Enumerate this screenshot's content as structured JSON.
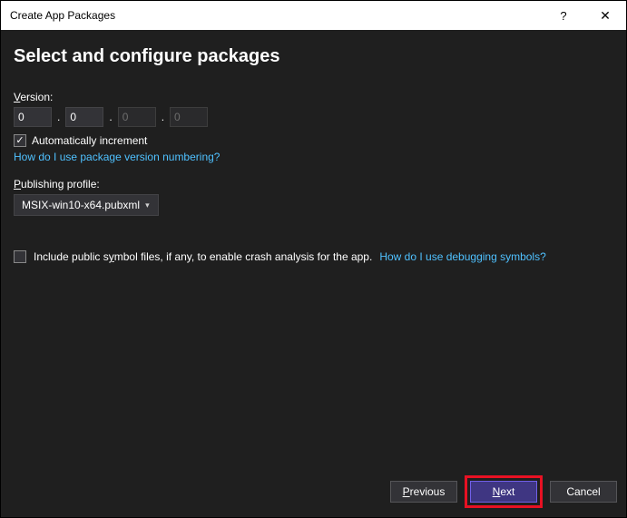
{
  "titlebar": {
    "title": "Create App Packages",
    "help": "?",
    "close": "✕"
  },
  "heading": "Select and configure packages",
  "version": {
    "label_prefix": "V",
    "label_rest": "ersion:",
    "major": "0",
    "minor": "0",
    "build": "0",
    "revision": "0"
  },
  "auto_increment": {
    "check": "✓",
    "label": "Automatically increment"
  },
  "version_link": "How do I use package version numbering?",
  "publishing": {
    "label_prefix": "P",
    "label_rest": "ublishing profile:",
    "selected": "MSIX-win10-x64.pubxml"
  },
  "symbols": {
    "label_before": "Include public s",
    "label_access": "y",
    "label_after": "mbol files, if any, to enable crash analysis for the app.",
    "link": "How do I use debugging symbols?"
  },
  "footer": {
    "previous_prefix": "P",
    "previous_rest": "revious",
    "next_prefix": "N",
    "next_rest": "ext",
    "cancel": "Cancel"
  }
}
